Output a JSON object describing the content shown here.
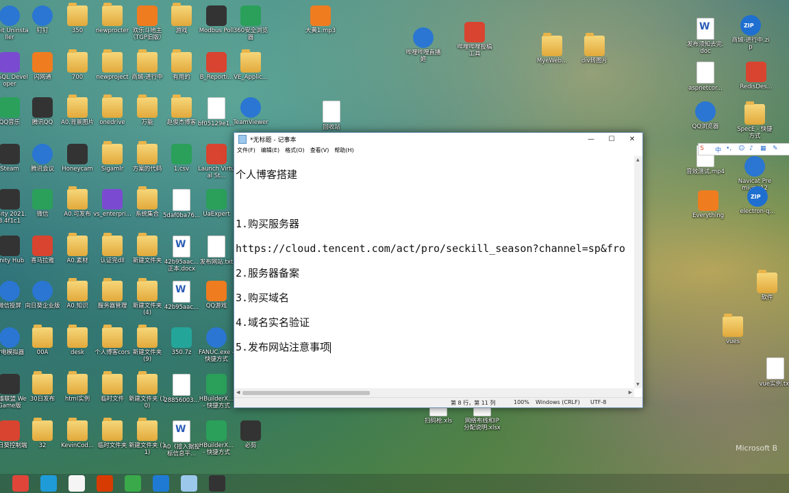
{
  "desktop_icons": [
    {
      "label": "IObit Uninstaller",
      "kind": "blue"
    },
    {
      "label": "钉钉",
      "kind": "blue"
    },
    {
      "label": "350",
      "kind": "folder"
    },
    {
      "label": "newprocter",
      "kind": "folder"
    },
    {
      "label": "欢乐斗地主（TGP旧版）",
      "kind": "orange"
    },
    {
      "label": "游戏",
      "kind": "folder"
    },
    {
      "label": "Modbus Poll",
      "kind": "dark"
    },
    {
      "label": "360安全浏览器",
      "kind": "green"
    },
    {
      "label": "大黄1.mp3",
      "kind": "orange"
    },
    {
      "label": "PLSQL Developer",
      "kind": "purple"
    },
    {
      "label": "闪网通",
      "kind": "orange"
    },
    {
      "label": "700",
      "kind": "folder"
    },
    {
      "label": "newproject",
      "kind": "folder"
    },
    {
      "label": "商城-进行中",
      "kind": "folder"
    },
    {
      "label": "有用的",
      "kind": "folder"
    },
    {
      "label": "B_Reporti...",
      "kind": "red"
    },
    {
      "label": "VE_Applic...",
      "kind": "folder"
    },
    {
      "label": "QQ音乐",
      "kind": "green"
    },
    {
      "label": "腾讯QQ",
      "kind": "dark"
    },
    {
      "label": "A0.背景图片",
      "kind": "folder"
    },
    {
      "label": "onedrive",
      "kind": "folder"
    },
    {
      "label": "万能",
      "kind": "folder"
    },
    {
      "label": "赵俊杰博客",
      "kind": "folder"
    },
    {
      "label": "bf05129e1...",
      "kind": "doc"
    },
    {
      "label": "TeamViewer",
      "kind": "blue"
    },
    {
      "label": "Steam",
      "kind": "dark"
    },
    {
      "label": "腾讯会议",
      "kind": "blue"
    },
    {
      "label": "Honeycam",
      "kind": "dark"
    },
    {
      "label": "Sigamlr",
      "kind": "folder"
    },
    {
      "label": "方案的代码",
      "kind": "folder"
    },
    {
      "label": "1.csv",
      "kind": "green"
    },
    {
      "label": "Launch Virtual St...",
      "kind": "red"
    },
    {
      "label": "Unity 2021.3.4f1c1",
      "kind": "dark"
    },
    {
      "label": "微信",
      "kind": "green"
    },
    {
      "label": "A0.可发布",
      "kind": "folder"
    },
    {
      "label": "vs_enterpri...",
      "kind": "purple"
    },
    {
      "label": "系统集合",
      "kind": "folder"
    },
    {
      "label": "5daf0ba76...",
      "kind": "doc"
    },
    {
      "label": "UaExpert",
      "kind": "green"
    },
    {
      "label": "Unity Hub",
      "kind": "dark"
    },
    {
      "label": "喜马拉雅",
      "kind": "red"
    },
    {
      "label": "A0.素材",
      "kind": "folder"
    },
    {
      "label": "认证完dll",
      "kind": "folder"
    },
    {
      "label": "新建文件夹",
      "kind": "folder"
    },
    {
      "label": "42b95aac...正本.docx",
      "kind": "word"
    },
    {
      "label": "发布网站.txt",
      "kind": "doc"
    },
    {
      "label": "微信投屏",
      "kind": "blue"
    },
    {
      "label": "向日葵企业版",
      "kind": "blue"
    },
    {
      "label": "A0.知识",
      "kind": "folder"
    },
    {
      "label": "服务器管理",
      "kind": "folder"
    },
    {
      "label": "新建文件夹 (4)",
      "kind": "folder"
    },
    {
      "label": "42b95aac...",
      "kind": "word"
    },
    {
      "label": "QQ游戏",
      "kind": "orange"
    },
    {
      "label": "雷电模拟器",
      "kind": "blue"
    },
    {
      "label": "00A",
      "kind": "folder"
    },
    {
      "label": "desk",
      "kind": "folder"
    },
    {
      "label": "个人博客cors",
      "kind": "folder"
    },
    {
      "label": "新建文件夹 (9)",
      "kind": "folder"
    },
    {
      "label": "350.7z",
      "kind": "teal"
    },
    {
      "label": "FANUC.exe - 快捷方式",
      "kind": "blue"
    },
    {
      "label": "英雄联盟 WeGame版",
      "kind": "dark"
    },
    {
      "label": "30日发布",
      "kind": "folder"
    },
    {
      "label": "html实例",
      "kind": "folder"
    },
    {
      "label": "临时文件",
      "kind": "folder"
    },
    {
      "label": "新建文件夹 (10)",
      "kind": "folder"
    },
    {
      "label": "28856003...",
      "kind": "doc"
    },
    {
      "label": "HBuilderX... - 快捷方式",
      "kind": "green"
    },
    {
      "label": "向日葵控制端",
      "kind": "red"
    },
    {
      "label": "32",
      "kind": "folder"
    },
    {
      "label": "KevinCod...",
      "kind": "folder"
    },
    {
      "label": "临时文件夹",
      "kind": "folder"
    },
    {
      "label": "新建文件夹 (11)",
      "kind": "folder"
    },
    {
      "label": "A0《接入据投标信息平...",
      "kind": "word"
    },
    {
      "label": "HBuilderX... - 快捷方式",
      "kind": "green"
    },
    {
      "label": "必剪",
      "kind": "dark"
    },
    {
      "label": "哔哩哔哩直播姬",
      "kind": "blue"
    },
    {
      "label": "哔哩哔哩投稿工具",
      "kind": "red"
    },
    {
      "label": "MyeWeb...",
      "kind": "folder"
    },
    {
      "label": "div转图片",
      "kind": "folder"
    },
    {
      "label": "回收站",
      "kind": "doc"
    },
    {
      "label": "发布须知去完.doc",
      "kind": "word"
    },
    {
      "label": "商城-进行中.zip",
      "kind": "zip"
    },
    {
      "label": "aspnetcor...",
      "kind": "doc"
    },
    {
      "label": "RedisDes...",
      "kind": "red"
    },
    {
      "label": "QQ浏览器",
      "kind": "blue"
    },
    {
      "label": "SpecE - 快捷方式",
      "kind": "folder"
    },
    {
      "label": "音效测试.mp4",
      "kind": "doc"
    },
    {
      "label": "Navicat Premium 12",
      "kind": "blue"
    },
    {
      "label": "Everything",
      "kind": "orange"
    },
    {
      "label": "electron-q...",
      "kind": "zip"
    },
    {
      "label": "软件",
      "kind": "folder"
    },
    {
      "label": "vues",
      "kind": "folder"
    },
    {
      "label": "vue实例.txt",
      "kind": "doc"
    },
    {
      "label": "扫码枪.xls",
      "kind": "doc"
    },
    {
      "label": "网络布线和IP分配说明.xlsx",
      "kind": "doc"
    }
  ],
  "notepad": {
    "title": "*无标题 - 记事本",
    "menu": [
      "文件(F)",
      "编辑(E)",
      "格式(O)",
      "查看(V)",
      "帮助(H)"
    ],
    "minimize": "—",
    "maximize": "☐",
    "close": "✕",
    "lines": [
      "个人博客搭建",
      "",
      "1.购买服务器",
      "https://cloud.tencent.com/act/pro/seckill_season?channel=sp&fro",
      "2.服务器备案",
      "3.购买域名",
      "4.域名实名验证",
      "5.发布网站注意事项"
    ],
    "status": {
      "position": "第 8 行，第 11 列",
      "zoom": "100%",
      "eol": "Windows (CRLF)",
      "encoding": "UTF-8"
    }
  },
  "ime_toolbar": {
    "label": "中"
  },
  "watermark": "Microsoft B",
  "taskbar_apps": [
    {
      "name": "chrome",
      "color": "#e0453a"
    },
    {
      "name": "edge",
      "color": "#1f9bd8"
    },
    {
      "name": "sunlogin",
      "color": "#f5f5f5"
    },
    {
      "name": "office",
      "color": "#d83b01"
    },
    {
      "name": "360browser",
      "color": "#3aa94a"
    },
    {
      "name": "vscode",
      "color": "#1f7ad4"
    },
    {
      "name": "notepad",
      "color": "#9cc8ec"
    },
    {
      "name": "bilibili-cut",
      "color": "#333333"
    }
  ]
}
